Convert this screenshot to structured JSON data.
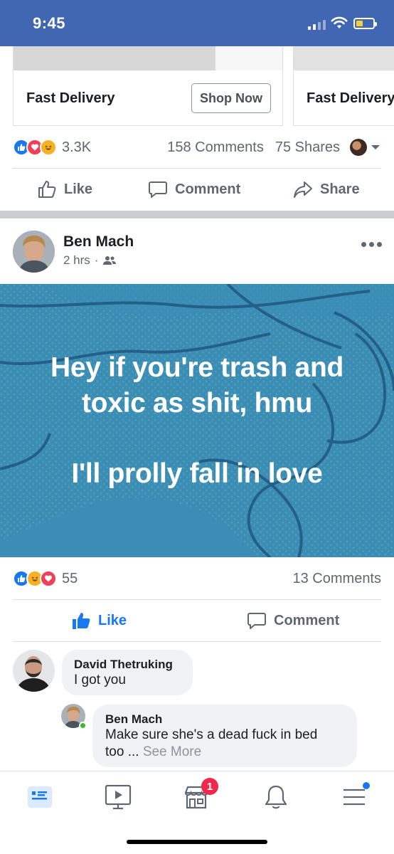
{
  "status_bar": {
    "time": "9:45"
  },
  "ad": {
    "cards": [
      {
        "title": "Fast Delivery",
        "button": "Shop Now"
      },
      {
        "title": "Fast Delivery"
      }
    ],
    "stats": {
      "reaction_count": "3.3K",
      "comments": "158 Comments",
      "shares": "75 Shares"
    },
    "actions": {
      "like": "Like",
      "comment": "Comment",
      "share": "Share"
    }
  },
  "post": {
    "author": "Ben Mach",
    "time": "2 hrs",
    "audience_icon": "friends-icon",
    "background_color": "#3a8fb5",
    "text_lines": [
      "Hey if you're trash and",
      "toxic as shit, hmu",
      "I'll prolly fall in love"
    ],
    "stats": {
      "reaction_count": "55",
      "comments": "13 Comments"
    },
    "actions": {
      "like": "Like",
      "comment": "Comment"
    },
    "comments": [
      {
        "author": "David Thetruking",
        "text": "I got you"
      },
      {
        "author": "Ben Mach",
        "text_line1": "Make sure she's a dead fuck in bed",
        "text_line2": "too ...",
        "see_more": "See More"
      }
    ]
  },
  "bottom_nav": {
    "items": [
      "news-feed-icon",
      "watch-icon",
      "marketplace-icon",
      "notifications-icon",
      "menu-icon"
    ],
    "marketplace_badge": "1",
    "accent": "#1877f2"
  }
}
